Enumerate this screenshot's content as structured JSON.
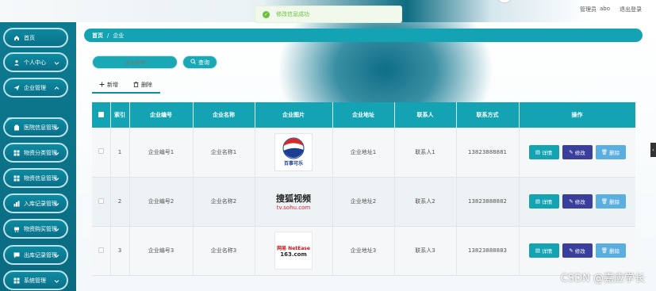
{
  "topbar": {
    "role": "管理员",
    "username": "abo",
    "logout_label": "退出登录"
  },
  "toast": {
    "message": "修改信息成功",
    "icon": "check-circle-icon",
    "color": "#67c23a"
  },
  "sidebar": {
    "items": [
      {
        "label": "首页",
        "icon": "home-icon"
      },
      {
        "label": "个人中心",
        "icon": "user-icon"
      },
      {
        "label": "企业管理",
        "icon": "send-icon",
        "expanded": true
      },
      {
        "label": "医院信息管理",
        "icon": "building-icon"
      },
      {
        "label": "物资分类管理",
        "icon": "grid-icon"
      },
      {
        "label": "物资信息管理",
        "icon": "grid-icon"
      },
      {
        "label": "入库记录管理",
        "icon": "chart-icon"
      },
      {
        "label": "物资购买管理",
        "icon": "cart-icon"
      },
      {
        "label": "出库记录管理",
        "icon": "message-icon"
      },
      {
        "label": "系统管理",
        "icon": "grid-icon"
      }
    ],
    "active_sub": "企业"
  },
  "breadcrumb": {
    "home": "首页",
    "separator": "/",
    "current": "企业"
  },
  "search": {
    "placeholder": "企业名称",
    "button_label": "查询"
  },
  "actions": {
    "add_label": "新增",
    "delete_label": "删除"
  },
  "table": {
    "headers": [
      "",
      "索引",
      "企业编号",
      "企业名称",
      "企业图片",
      "企业地址",
      "联系人",
      "联系方式",
      "操作"
    ],
    "rows": [
      {
        "index": "1",
        "code": "企业编号1",
        "name": "企业名称1",
        "logo": "pepsi",
        "address": "企业地址1",
        "contact": "联系人1",
        "phone": "13823888881"
      },
      {
        "index": "2",
        "code": "企业编号2",
        "name": "企业名称2",
        "logo": "sohu",
        "address": "企业地址2",
        "contact": "联系人2",
        "phone": "13823888882"
      },
      {
        "index": "3",
        "code": "企业编号3",
        "name": "企业名称3",
        "logo": "netease",
        "address": "企业地址3",
        "contact": "联系人3",
        "phone": "13823888883"
      }
    ],
    "op_labels": {
      "detail": "详情",
      "edit": "修改",
      "delete": "删除"
    }
  },
  "logos": {
    "pepsi_text": "百事可乐",
    "sohu_text": "搜狐视频",
    "sohu_url": "tv.sohu.com",
    "netease_text": "网易 NetEase",
    "netease_sub": "163.com"
  },
  "watermark": "CSDN @嘉应学长",
  "colors": {
    "primary": "#14a3b2",
    "sidebar": "#0e7a90",
    "edit": "#3a3f9c",
    "delete": "#5aaee0"
  }
}
